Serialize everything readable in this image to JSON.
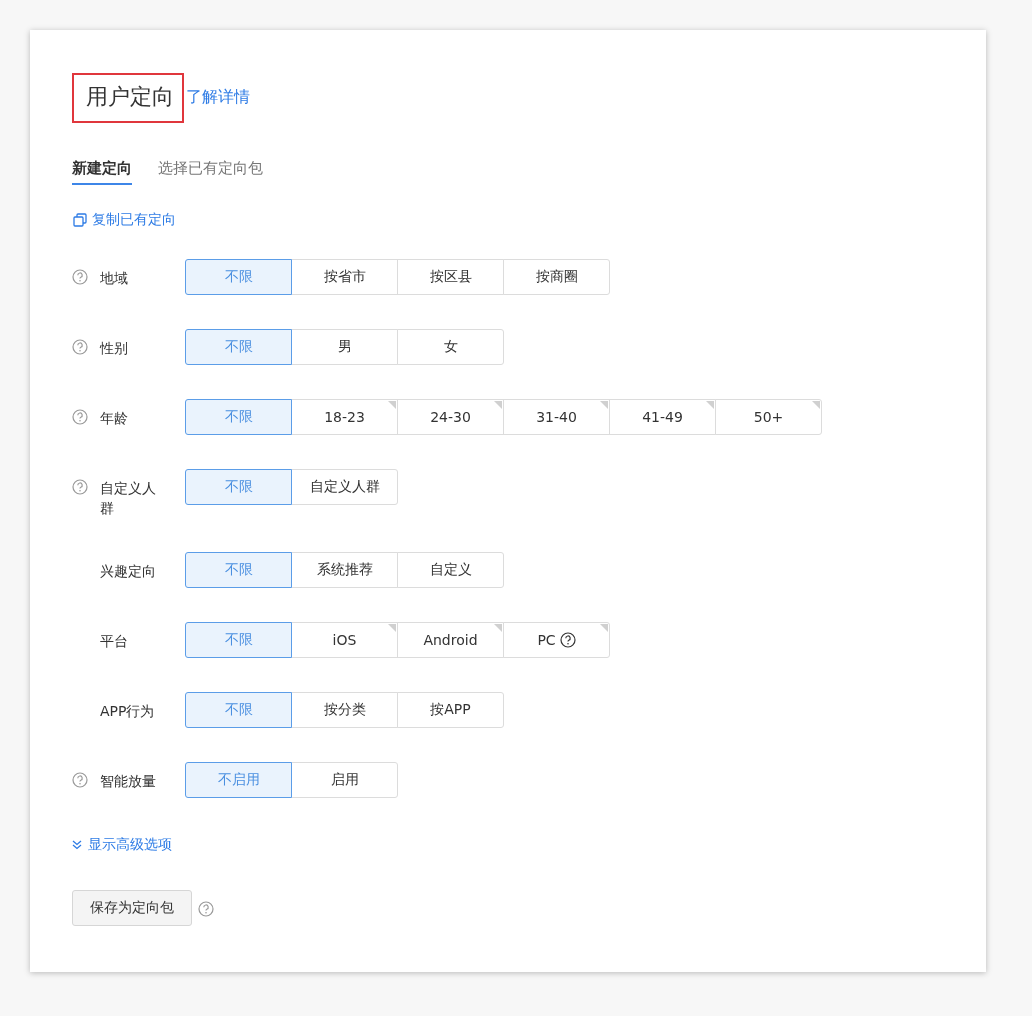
{
  "header": {
    "title": "用户定向",
    "link": "了解详情"
  },
  "tabs": [
    {
      "label": "新建定向",
      "selected": true
    },
    {
      "label": "选择已有定向包",
      "selected": false
    }
  ],
  "copy_link": "复制已有定向",
  "rows": [
    {
      "label": "地域",
      "help": true,
      "options": [
        {
          "label": "不限",
          "selected": true,
          "corner": false,
          "help": false
        },
        {
          "label": "按省市",
          "selected": false,
          "corner": false,
          "help": false
        },
        {
          "label": "按区县",
          "selected": false,
          "corner": false,
          "help": false
        },
        {
          "label": "按商圈",
          "selected": false,
          "corner": false,
          "help": false
        }
      ]
    },
    {
      "label": "性别",
      "help": true,
      "options": [
        {
          "label": "不限",
          "selected": true,
          "corner": false,
          "help": false
        },
        {
          "label": "男",
          "selected": false,
          "corner": false,
          "help": false
        },
        {
          "label": "女",
          "selected": false,
          "corner": false,
          "help": false
        }
      ]
    },
    {
      "label": "年龄",
      "help": true,
      "options": [
        {
          "label": "不限",
          "selected": true,
          "corner": false,
          "help": false
        },
        {
          "label": "18-23",
          "selected": false,
          "corner": true,
          "help": false
        },
        {
          "label": "24-30",
          "selected": false,
          "corner": true,
          "help": false
        },
        {
          "label": "31-40",
          "selected": false,
          "corner": true,
          "help": false
        },
        {
          "label": "41-49",
          "selected": false,
          "corner": true,
          "help": false
        },
        {
          "label": "50+",
          "selected": false,
          "corner": true,
          "help": false
        }
      ]
    },
    {
      "label": "自定义人群",
      "help": true,
      "options": [
        {
          "label": "不限",
          "selected": true,
          "corner": false,
          "help": false
        },
        {
          "label": "自定义人群",
          "selected": false,
          "corner": false,
          "help": false
        }
      ]
    },
    {
      "label": "兴趣定向",
      "help": false,
      "options": [
        {
          "label": "不限",
          "selected": true,
          "corner": false,
          "help": false
        },
        {
          "label": "系统推荐",
          "selected": false,
          "corner": false,
          "help": false
        },
        {
          "label": "自定义",
          "selected": false,
          "corner": false,
          "help": false
        }
      ]
    },
    {
      "label": "平台",
      "help": false,
      "options": [
        {
          "label": "不限",
          "selected": true,
          "corner": false,
          "help": false
        },
        {
          "label": "iOS",
          "selected": false,
          "corner": true,
          "help": false
        },
        {
          "label": "Android",
          "selected": false,
          "corner": true,
          "help": false
        },
        {
          "label": "PC",
          "selected": false,
          "corner": true,
          "help": true
        }
      ]
    },
    {
      "label": "APP行为",
      "help": false,
      "options": [
        {
          "label": "不限",
          "selected": true,
          "corner": false,
          "help": false
        },
        {
          "label": "按分类",
          "selected": false,
          "corner": false,
          "help": false
        },
        {
          "label": "按APP",
          "selected": false,
          "corner": false,
          "help": false
        }
      ]
    },
    {
      "label": "智能放量",
      "help": true,
      "options": [
        {
          "label": "不启用",
          "selected": true,
          "corner": false,
          "help": false
        },
        {
          "label": "启用",
          "selected": false,
          "corner": false,
          "help": false
        }
      ]
    }
  ],
  "advanced_toggle": "显示高级选项",
  "save_button": "保存为定向包"
}
